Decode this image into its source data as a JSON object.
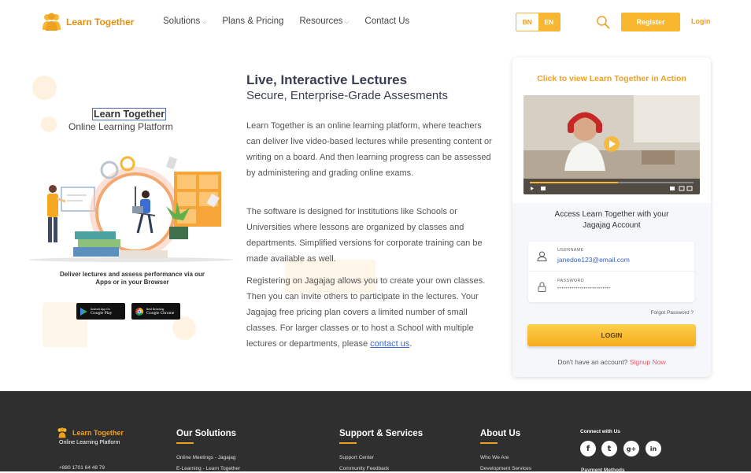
{
  "header": {
    "brand": "Learn Together",
    "nav": [
      {
        "label": "Solutions",
        "has_caret": true
      },
      {
        "label": "Plans & Pricing",
        "has_caret": false
      },
      {
        "label": "Resources",
        "has_caret": true
      },
      {
        "label": "Contact Us",
        "has_caret": false
      }
    ],
    "lang_bn": "BN",
    "lang_en": "EN",
    "register": "Register",
    "login": "Login",
    "caret": "⌵"
  },
  "hero": {
    "brand": "Learn Together",
    "subtitle": "Online Learning Platform",
    "caption_line1": "Deliver lectures and assess performance via our",
    "caption_line2": "Apps or in your Browser",
    "play_store_small": "Android App On",
    "play_store": "Google Play",
    "chrome_small": "Best Browsing",
    "chrome": "Google Chrome"
  },
  "main": {
    "title": "Live, Interactive Lectures",
    "subtitle": "Secure, Enterprise-Grade Assesments",
    "p1": "Learn Together is an online learning platform, where teachers can deliver live video-based lectures while presenting content or writing on a board. And then learning progress can be assessed by administering and grading online exams.",
    "p2": "The software is designed for institutions like Schools or Universities where lessons are organized by classes and departments. Simplified versions for corporate training can be made available as well.",
    "p3": "Registering on Jagajag allows you to create your own classes. Then you can invite others to participate in the lectures. Your Jagajag free pricing plan covers a limited number of small classes. For larger classes or to host a School with multiple lectures or departments, please",
    "p3_link": "contact us",
    "p3_end": "."
  },
  "card": {
    "cta": "Click to view Learn Together in Action",
    "access_line1": "Access Learn Together with your",
    "access_line2": "Jagajag Account",
    "username_label": "USERNAME",
    "username_value": "janedoe123@email.com",
    "password_label": "PASSWORD",
    "password_value": "••••••••••••••••••••••••••",
    "forgot": "Forgot Password ?",
    "login_btn": "LOGIN",
    "no_account": "Don't have an account?",
    "signup": "Signup Now"
  },
  "footer": {
    "brand": "Learn Together",
    "brand_sub": "Online Learning Platform",
    "phone": "+880 1701 64 48 79",
    "col1_head": "Our Solutions",
    "col1_links": [
      "Online Meetings - Jagajag",
      "E-Learning - Learn Together"
    ],
    "col2_head": "Support & Services",
    "col2_links": [
      "Support Center",
      "Community Feedback"
    ],
    "col3_head": "About Us",
    "col3_links": [
      "Who We Are",
      "Development Services"
    ],
    "connect": "Connect with Us",
    "social": [
      "f",
      "t",
      "g+",
      "in"
    ],
    "payment": "Payment Methods"
  },
  "colors": {
    "accent": "#f7b733",
    "accent_dark": "#f0a020",
    "footer_bg": "#2f2f2f",
    "link": "#3867d6"
  }
}
